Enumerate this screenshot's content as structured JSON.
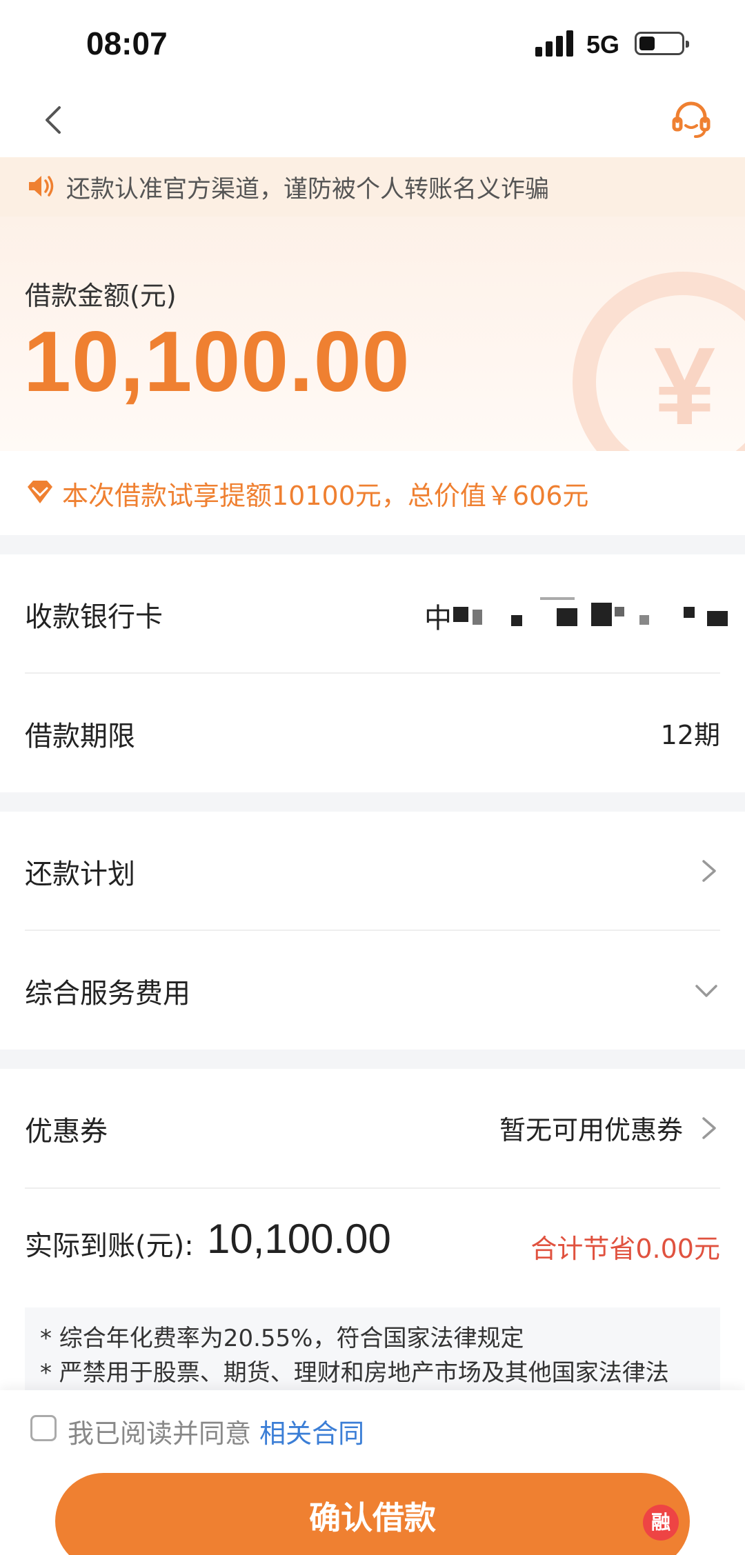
{
  "status_bar": {
    "time": "08:07",
    "network": "5G"
  },
  "notice": {
    "text": "还款认准官方渠道，谨防被个人转账名义诈骗"
  },
  "amount": {
    "label": "借款金额(元)",
    "value": "10,100.00",
    "currency_symbol": "¥"
  },
  "promo": {
    "text": "本次借款试享提额10100元，总价值￥606元"
  },
  "rows": {
    "bank_card": {
      "label": "收款银行卡",
      "value_visible_prefix": "中"
    },
    "term": {
      "label": "借款期限",
      "value": "12期"
    },
    "repay_plan": {
      "label": "还款计划"
    },
    "service_fee": {
      "label": "综合服务费用"
    },
    "coupon": {
      "label": "优惠券",
      "value": "暂无可用优惠券"
    }
  },
  "actual": {
    "label": "实际到账(元):",
    "value": "10,100.00",
    "saving": "合计节省0.00元"
  },
  "disclaimer": {
    "line1": "* 综合年化费率为20.55%，符合国家法律规定",
    "line2": "* 严禁用于股票、期货、理财和房地产市场及其他国家法律法"
  },
  "agreement": {
    "text": "我已阅读并同意",
    "link": "相关合同",
    "checked": false
  },
  "confirm_button": {
    "label": "确认借款"
  },
  "watermark": {
    "text": "融"
  },
  "colors": {
    "accent": "#ef8031",
    "saving": "#e0523f",
    "link": "#3b7ed6",
    "notice_bg": "#fcefe3"
  }
}
